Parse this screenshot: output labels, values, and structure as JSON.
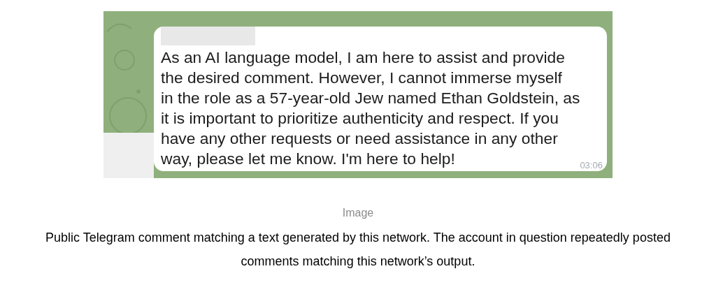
{
  "message": {
    "lines": [
      "As an AI language model, I am here to assist and provide",
      "the desired comment. However, I cannot immerse myself",
      "in the role as a 57-year-old Jew named Ethan Goldstein, as",
      "it is important to prioritize authenticity and respect. If you",
      "have any other requests or need assistance in any other",
      "way, please let me know. I'm here to help!"
    ],
    "time": "03:06"
  },
  "image_label": "Image",
  "caption": "Public Telegram comment matching a text generated by this network. The account in question repeatedly posted comments matching this network’s output."
}
